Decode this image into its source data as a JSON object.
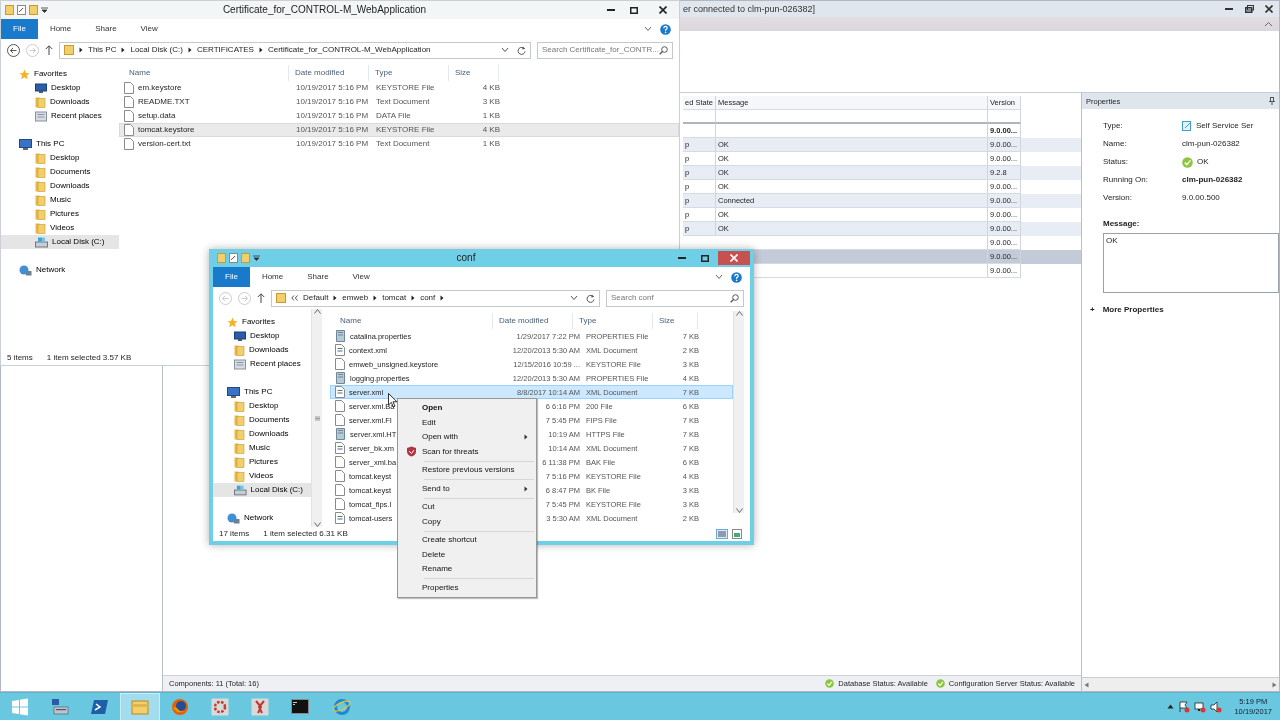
{
  "background_app": {
    "title": "er connected to clm-pun-026382]",
    "grid": {
      "columns": [
        "ed State",
        "Message",
        "Version"
      ],
      "rows": [
        {
          "kind": "group",
          "version": "9.0.00...",
          "selected": false
        },
        {
          "kind": "row",
          "state": "p",
          "message": "OK",
          "version": "9.0.00...",
          "selected": false
        },
        {
          "kind": "row",
          "state": "p",
          "message": "OK",
          "version": "9.0.00...",
          "selected": false
        },
        {
          "kind": "row",
          "state": "p",
          "message": "OK",
          "version": "9.2.8",
          "selected": false
        },
        {
          "kind": "row",
          "state": "p",
          "message": "OK",
          "version": "9.0.00...",
          "selected": false
        },
        {
          "kind": "row",
          "state": "p",
          "message": "Connected",
          "version": "9.0.00...",
          "selected": false
        },
        {
          "kind": "row",
          "state": "p",
          "message": "OK",
          "version": "9.0.00...",
          "selected": false
        },
        {
          "kind": "row",
          "state": "p",
          "message": "OK",
          "version": "9.0.00...",
          "selected": false
        },
        {
          "kind": "row",
          "version": "9.0.00...",
          "selected": false
        },
        {
          "kind": "row",
          "version": "9.0.00...",
          "selected": true
        },
        {
          "kind": "row",
          "version": "9.0.00...",
          "selected": false
        }
      ]
    },
    "properties": {
      "title": "Properties",
      "fields": [
        {
          "label": "Type:",
          "value": "Self Service Ser",
          "kind": "service"
        },
        {
          "label": "Name:",
          "value": "clm-pun-026382",
          "kind": "text"
        },
        {
          "label": "Status:",
          "value": "OK",
          "kind": "status"
        },
        {
          "label": "Running On:",
          "value": "clm-pun-026382",
          "kind": "bold"
        },
        {
          "label": "Version:",
          "value": "9.0.00.500",
          "kind": "text"
        }
      ],
      "message_label": "Message:",
      "message": "OK",
      "expander": "+",
      "more_link": "More Properties"
    },
    "status_bar": {
      "components": "Components: 11 (Total: 16)",
      "statuses": [
        "Database Status: Available",
        "Configuration Server Status: Available"
      ]
    }
  },
  "explorer_windows": [
    {
      "title": "Certificate_for_CONTROL-M_WebApplication",
      "active": false,
      "tabs": [
        "File",
        "Home",
        "Share",
        "View"
      ],
      "address": {
        "overflow": false,
        "crumbs": [
          "This PC",
          "Local Disk (C:)",
          "CERTIFICATES",
          "Certificate_for_CONTROL-M_WebApplication"
        ]
      },
      "search_placeholder": "Search Certificate_for_CONTR...",
      "nav": [
        {
          "label": "Favorites",
          "kind": "star",
          "selected": false,
          "children": [
            {
              "label": "Desktop",
              "kind": "desktop",
              "selected": false
            },
            {
              "label": "Downloads",
              "kind": "folder",
              "selected": false
            },
            {
              "label": "Recent places",
              "kind": "recent",
              "selected": false
            }
          ]
        },
        {
          "label": "This PC",
          "kind": "computer",
          "selected": false,
          "children": [
            {
              "label": "Desktop",
              "kind": "folder",
              "selected": false
            },
            {
              "label": "Documents",
              "kind": "folder",
              "selected": false
            },
            {
              "label": "Downloads",
              "kind": "folder",
              "selected": false
            },
            {
              "label": "Music",
              "kind": "folder",
              "selected": false
            },
            {
              "label": "Pictures",
              "kind": "folder",
              "selected": false
            },
            {
              "label": "Videos",
              "kind": "folder",
              "selected": false
            },
            {
              "label": "Local Disk (C:)",
              "kind": "drive",
              "selected": true
            }
          ]
        },
        {
          "label": "Network",
          "kind": "network",
          "selected": false
        }
      ],
      "columns": [
        "Name",
        "Date modified",
        "Type",
        "Size"
      ],
      "files": [
        {
          "name": "em.keystore",
          "date": "10/19/2017 5:16 PM",
          "type": "KEYSTORE File",
          "size": "4 KB",
          "kind": "file",
          "selected": false
        },
        {
          "name": "README.TXT",
          "date": "10/19/2017 5:16 PM",
          "type": "Text Document",
          "size": "3 KB",
          "kind": "file",
          "selected": false
        },
        {
          "name": "setup.data",
          "date": "10/19/2017 5:16 PM",
          "type": "DATA File",
          "size": "1 KB",
          "kind": "file",
          "selected": false
        },
        {
          "name": "tomcat.keystore",
          "date": "10/19/2017 5:16 PM",
          "type": "KEYSTORE File",
          "size": "4 KB",
          "kind": "file",
          "selected": true
        },
        {
          "name": "version-cert.txt",
          "date": "10/19/2017 5:16 PM",
          "type": "Text Document",
          "size": "1 KB",
          "kind": "file",
          "selected": false
        }
      ],
      "status": {
        "count": "5 items",
        "selection": "1 item selected  3.57 KB"
      }
    },
    {
      "title": "conf",
      "active": true,
      "tabs": [
        "File",
        "Home",
        "Share",
        "View"
      ],
      "address": {
        "overflow": true,
        "crumbs": [
          "Default",
          "emweb",
          "tomcat",
          "conf"
        ]
      },
      "search_placeholder": "Search conf",
      "nav": [
        {
          "label": "Favorites",
          "kind": "star",
          "selected": false,
          "children": [
            {
              "label": "Desktop",
              "kind": "desktop",
              "selected": false
            },
            {
              "label": "Downloads",
              "kind": "folder",
              "selected": false
            },
            {
              "label": "Recent places",
              "kind": "recent",
              "selected": false
            }
          ]
        },
        {
          "label": "This PC",
          "kind": "computer",
          "selected": false,
          "children": [
            {
              "label": "Desktop",
              "kind": "folder",
              "selected": false
            },
            {
              "label": "Documents",
              "kind": "folder",
              "selected": false
            },
            {
              "label": "Downloads",
              "kind": "folder",
              "selected": false
            },
            {
              "label": "Music",
              "kind": "folder",
              "selected": false
            },
            {
              "label": "Pictures",
              "kind": "folder",
              "selected": false
            },
            {
              "label": "Videos",
              "kind": "folder",
              "selected": false
            },
            {
              "label": "Local Disk (C:)",
              "kind": "drive",
              "selected": true
            }
          ]
        },
        {
          "label": "Network",
          "kind": "network",
          "selected": false
        }
      ],
      "columns": [
        "Name",
        "Date modified",
        "Type",
        "Size"
      ],
      "files": [
        {
          "name": "catalina.properties",
          "date": "1/29/2017 7:22 PM",
          "type": "PROPERTIES File",
          "size": "7 KB",
          "kind": "properties",
          "selected": false
        },
        {
          "name": "context.xml",
          "date": "12/20/2013 5:30 AM",
          "type": "XML Document",
          "size": "2 KB",
          "kind": "xml",
          "selected": false
        },
        {
          "name": "emweb_unsigned.keystore",
          "date": "12/15/2016 10:59 ...",
          "type": "KEYSTORE File",
          "size": "3 KB",
          "kind": "file",
          "selected": false
        },
        {
          "name": "logging.properties",
          "date": "12/20/2013 5:30 AM",
          "type": "PROPERTIES File",
          "size": "4 KB",
          "kind": "properties",
          "selected": false
        },
        {
          "name": "server.xml",
          "date": "8/8/2017 10:14 AM",
          "type": "XML Document",
          "size": "7 KB",
          "kind": "xml",
          "selected": true
        },
        {
          "name": "server.xml.Ba",
          "date": "6 6:16 PM",
          "type": "200 File",
          "size": "6 KB",
          "kind": "file",
          "selected": false
        },
        {
          "name": "server.xml.FI",
          "date": "7 5:45 PM",
          "type": "FIPS File",
          "size": "7 KB",
          "kind": "file",
          "selected": false
        },
        {
          "name": "server.xml.HT",
          "date": "10:19 AM",
          "type": "HTTPS File",
          "size": "7 KB",
          "kind": "properties",
          "selected": false
        },
        {
          "name": "server_bk.xm",
          "date": "10:14 AM",
          "type": "XML Document",
          "size": "7 KB",
          "kind": "xml",
          "selected": false
        },
        {
          "name": "server_xml.ba",
          "date": "6 11:38 PM",
          "type": "BAK File",
          "size": "6 KB",
          "kind": "file",
          "selected": false
        },
        {
          "name": "tomcat.keyst",
          "date": "7 5:16 PM",
          "type": "KEYSTORE File",
          "size": "4 KB",
          "kind": "file",
          "selected": false
        },
        {
          "name": "tomcat.keyst",
          "date": "6 8:47 PM",
          "type": "BK File",
          "size": "3 KB",
          "kind": "file",
          "selected": false
        },
        {
          "name": "tomcat_fips.l",
          "date": "7 5:45 PM",
          "type": "KEYSTORE File",
          "size": "3 KB",
          "kind": "file",
          "selected": false
        },
        {
          "name": "tomcat-users",
          "date": "3 5:30 AM",
          "type": "XML Document",
          "size": "2 KB",
          "kind": "xml",
          "selected": false
        }
      ],
      "status": {
        "count": "17 items",
        "selection": "1 item selected  6.31 KB"
      }
    }
  ],
  "context_menu": [
    {
      "kind": "item",
      "label": "Open",
      "default": true,
      "submenu": false
    },
    {
      "kind": "item",
      "label": "Edit",
      "default": false,
      "submenu": false
    },
    {
      "kind": "item",
      "label": "Open with",
      "default": false,
      "submenu": true
    },
    {
      "kind": "shield_item",
      "label": "Scan for threats",
      "default": false,
      "submenu": false
    },
    {
      "kind": "separator"
    },
    {
      "kind": "item",
      "label": "Restore previous versions",
      "default": false,
      "submenu": false
    },
    {
      "kind": "separator"
    },
    {
      "kind": "item",
      "label": "Send to",
      "default": false,
      "submenu": true
    },
    {
      "kind": "separator"
    },
    {
      "kind": "item",
      "label": "Cut",
      "default": false,
      "submenu": false
    },
    {
      "kind": "item",
      "label": "Copy",
      "default": false,
      "submenu": false
    },
    {
      "kind": "separator"
    },
    {
      "kind": "item",
      "label": "Create shortcut",
      "default": false,
      "submenu": false
    },
    {
      "kind": "item",
      "label": "Delete",
      "default": false,
      "submenu": false
    },
    {
      "kind": "item",
      "label": "Rename",
      "default": false,
      "submenu": false
    },
    {
      "kind": "separator"
    },
    {
      "kind": "item",
      "label": "Properties",
      "default": false,
      "submenu": false
    }
  ],
  "taskbar": {
    "apps": [
      {
        "kind": "start",
        "active": false
      },
      {
        "kind": "server",
        "active": false
      },
      {
        "kind": "shell",
        "active": false
      },
      {
        "kind": "explorer",
        "active": true
      },
      {
        "kind": "firefox",
        "active": false
      },
      {
        "kind": "gear",
        "active": false
      },
      {
        "kind": "wrench",
        "active": false
      },
      {
        "kind": "terminal",
        "active": false
      },
      {
        "kind": "ie",
        "active": false
      }
    ],
    "time": "5:19 PM",
    "date": "10/19/2017"
  }
}
